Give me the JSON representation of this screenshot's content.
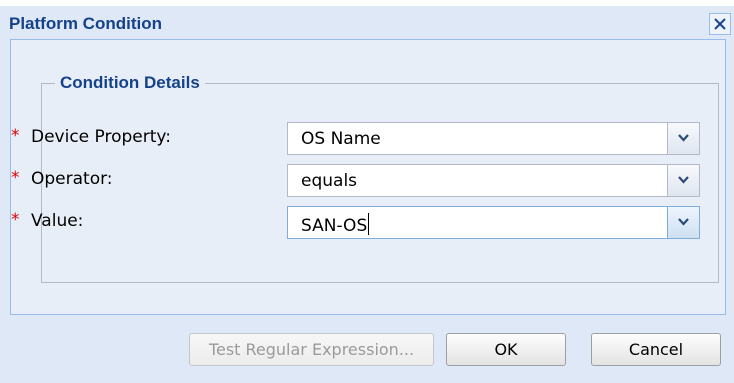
{
  "dialog": {
    "title": "Platform Condition",
    "close_icon": "close-icon"
  },
  "condition_details": {
    "legend": "Condition Details",
    "required_marker": "*",
    "fields": [
      {
        "label": "Device Property:",
        "value": "OS Name"
      },
      {
        "label": "Operator:",
        "value": "equals"
      },
      {
        "label": "Value:",
        "value": "SAN-OS"
      }
    ],
    "dropdown_icon": "chevron-down-icon"
  },
  "buttons": {
    "test_regex": "Test Regular Expression...",
    "ok": "OK",
    "cancel": "Cancel"
  },
  "colors": {
    "title_blue": "#15428b",
    "required_red": "#dd0000",
    "dialog_bg": "#dfe8f6"
  }
}
